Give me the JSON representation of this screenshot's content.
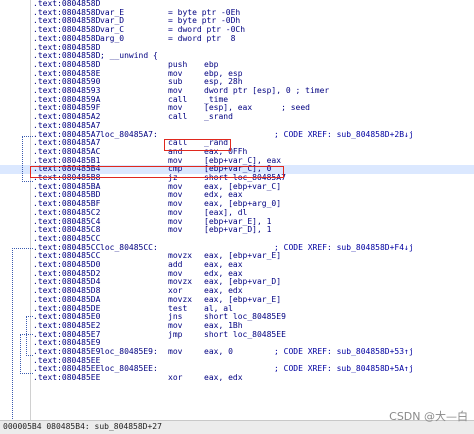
{
  "listing": {
    "lines": [
      {
        "addr": ".text:0804858D",
        "label": "",
        "mnem": "",
        "ops": "",
        "comment": ""
      },
      {
        "addr": ".text:0804858D",
        "label": "var_E",
        "mnem": "= byte ptr -0Eh",
        "ops": "",
        "comment": ""
      },
      {
        "addr": ".text:0804858D",
        "label": "var_D",
        "mnem": "= byte ptr -0Dh",
        "ops": "",
        "comment": ""
      },
      {
        "addr": ".text:0804858D",
        "label": "var_C",
        "mnem": "= dword ptr -0Ch",
        "ops": "",
        "comment": ""
      },
      {
        "addr": ".text:0804858D",
        "label": "arg_0",
        "mnem": "= dword ptr  8",
        "ops": "",
        "comment": ""
      },
      {
        "addr": ".text:0804858D",
        "label": "",
        "mnem": "",
        "ops": "",
        "comment": ""
      },
      {
        "addr": ".text:0804858D",
        "label": "; __unwind {",
        "mnem": "",
        "ops": "",
        "comment": ""
      },
      {
        "addr": ".text:0804858D",
        "label": "",
        "mnem": "push",
        "ops": "ebp",
        "comment": ""
      },
      {
        "addr": ".text:0804858E",
        "label": "",
        "mnem": "mov",
        "ops": "ebp, esp",
        "comment": ""
      },
      {
        "addr": ".text:08048590",
        "label": "",
        "mnem": "sub",
        "ops": "esp, 28h",
        "comment": ""
      },
      {
        "addr": ".text:08048593",
        "label": "",
        "mnem": "mov",
        "ops": "dword ptr [esp], 0 ; timer",
        "comment": ""
      },
      {
        "addr": ".text:0804859A",
        "label": "",
        "mnem": "call",
        "ops": "_time",
        "comment": ""
      },
      {
        "addr": ".text:0804859F",
        "label": "",
        "mnem": "mov",
        "ops": "[esp], eax      ; seed",
        "comment": ""
      },
      {
        "addr": ".text:080485A2",
        "label": "",
        "mnem": "call",
        "ops": "_srand",
        "comment": ""
      },
      {
        "addr": ".text:080485A7",
        "label": "",
        "mnem": "",
        "ops": "",
        "comment": ""
      },
      {
        "addr": ".text:080485A7",
        "label": "loc_80485A7:",
        "mnem": "",
        "ops": "",
        "comment": "; CODE XREF: sub_804858D+2B↓j"
      },
      {
        "addr": ".text:080485A7",
        "label": "",
        "mnem": "call",
        "ops": "_rand",
        "comment": ""
      },
      {
        "addr": ".text:080485AC",
        "label": "",
        "mnem": "and",
        "ops": "eax, 0FFh",
        "comment": ""
      },
      {
        "addr": ".text:080485B1",
        "label": "",
        "mnem": "mov",
        "ops": "[ebp+var_C], eax",
        "comment": ""
      },
      {
        "addr": ".text:080485B4",
        "label": "",
        "mnem": "cmp",
        "ops": "[ebp+var_C], 0",
        "comment": ""
      },
      {
        "addr": ".text:080485B8",
        "label": "",
        "mnem": "jz",
        "ops": "short loc_80485A7",
        "comment": ""
      },
      {
        "addr": ".text:080485BA",
        "label": "",
        "mnem": "mov",
        "ops": "eax, [ebp+var_C]",
        "comment": ""
      },
      {
        "addr": ".text:080485BD",
        "label": "",
        "mnem": "mov",
        "ops": "edx, eax",
        "comment": ""
      },
      {
        "addr": ".text:080485BF",
        "label": "",
        "mnem": "mov",
        "ops": "eax, [ebp+arg_0]",
        "comment": ""
      },
      {
        "addr": ".text:080485C2",
        "label": "",
        "mnem": "mov",
        "ops": "[eax], dl",
        "comment": ""
      },
      {
        "addr": ".text:080485C4",
        "label": "",
        "mnem": "mov",
        "ops": "[ebp+var_E], 1",
        "comment": ""
      },
      {
        "addr": ".text:080485C8",
        "label": "",
        "mnem": "mov",
        "ops": "[ebp+var_D], 1",
        "comment": ""
      },
      {
        "addr": ".text:080485CC",
        "label": "",
        "mnem": "",
        "ops": "",
        "comment": ""
      },
      {
        "addr": ".text:080485CC",
        "label": "loc_80485CC:",
        "mnem": "",
        "ops": "",
        "comment": "; CODE XREF: sub_804858D+F4↓j"
      },
      {
        "addr": ".text:080485CC",
        "label": "",
        "mnem": "movzx",
        "ops": "eax, [ebp+var_E]",
        "comment": ""
      },
      {
        "addr": ".text:080485D0",
        "label": "",
        "mnem": "add",
        "ops": "eax, eax",
        "comment": ""
      },
      {
        "addr": ".text:080485D2",
        "label": "",
        "mnem": "mov",
        "ops": "edx, eax",
        "comment": ""
      },
      {
        "addr": ".text:080485D4",
        "label": "",
        "mnem": "movzx",
        "ops": "eax, [ebp+var_D]",
        "comment": ""
      },
      {
        "addr": ".text:080485D8",
        "label": "",
        "mnem": "xor",
        "ops": "eax, edx",
        "comment": ""
      },
      {
        "addr": ".text:080485DA",
        "label": "",
        "mnem": "movzx",
        "ops": "eax, [ebp+var_E]",
        "comment": ""
      },
      {
        "addr": ".text:080485DE",
        "label": "",
        "mnem": "test",
        "ops": "al, al",
        "comment": ""
      },
      {
        "addr": ".text:080485E0",
        "label": "",
        "mnem": "jns",
        "ops": "short loc_80485E9",
        "comment": ""
      },
      {
        "addr": ".text:080485E2",
        "label": "",
        "mnem": "mov",
        "ops": "eax, 1Bh",
        "comment": ""
      },
      {
        "addr": ".text:080485E7",
        "label": "",
        "mnem": "jmp",
        "ops": "short loc_80485EE",
        "comment": ""
      },
      {
        "addr": ".text:080485E9",
        "label": "",
        "mnem": "",
        "ops": "",
        "comment": ""
      },
      {
        "addr": ".text:080485E9",
        "label": "loc_80485E9:",
        "mnem": "mov",
        "ops": "eax, 0",
        "comment": "; CODE XREF: sub_804858D+53↑j"
      },
      {
        "addr": ".text:080485EE",
        "label": "",
        "mnem": "",
        "ops": "",
        "comment": ""
      },
      {
        "addr": ".text:080485EE",
        "label": "loc_80485EE:",
        "mnem": "",
        "ops": "",
        "comment": "; CODE XREF: sub_804858D+5A↑j"
      },
      {
        "addr": ".text:080485EE",
        "label": "",
        "mnem": "xor",
        "ops": "eax, edx",
        "comment": ""
      }
    ],
    "highlighted_index": 19
  },
  "status": {
    "text": "000005B4 080485B4: sub_804858D+27"
  },
  "watermark": "CSDN @大—白",
  "colors": {
    "accent_box": "#e0281e",
    "highlight_row": "#dbe8ff",
    "code_text": "#000080"
  }
}
